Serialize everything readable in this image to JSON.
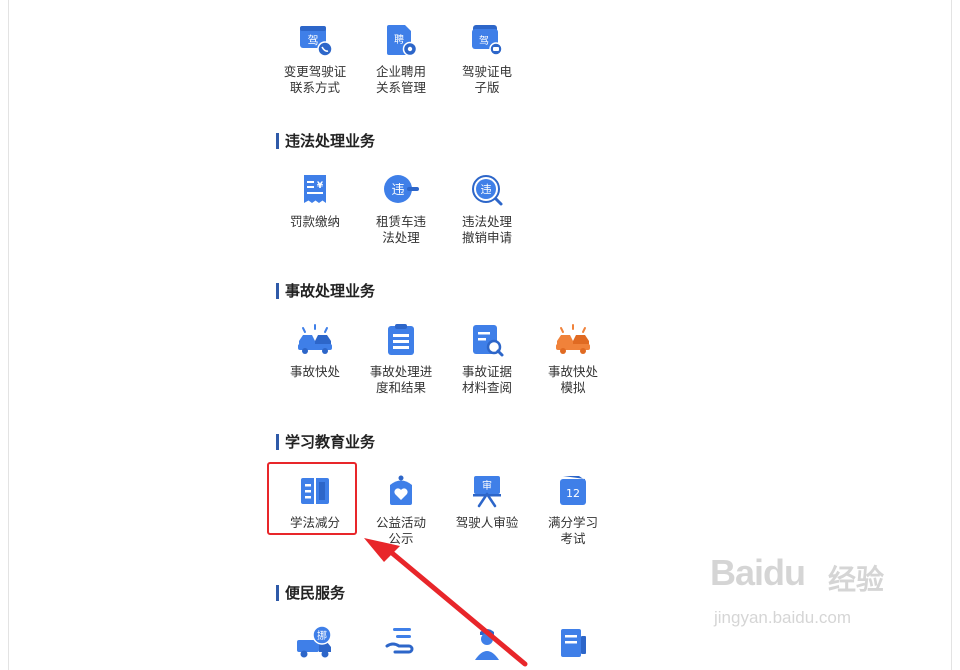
{
  "colors": {
    "icon_blue": "#3f7fe8",
    "icon_orange": "#f0823a",
    "section_bar": "#2f5aa8",
    "highlight_red": "#e8262a"
  },
  "top_row": {
    "items": [
      {
        "label": "变更驾驶证\n联系方式",
        "icon": "license-phone-icon",
        "glyph": "驾"
      },
      {
        "label": "企业聘用\n关系管理",
        "icon": "employment-doc-icon",
        "glyph": "聘"
      },
      {
        "label": "驾驶证电\n子版",
        "icon": "e-license-icon",
        "glyph": "驾"
      }
    ]
  },
  "violation": {
    "title": "违法处理业务",
    "items": [
      {
        "label": "罚款缴纳",
        "icon": "fine-receipt-icon",
        "glyph": "¥"
      },
      {
        "label": "租赁车违\n法处理",
        "icon": "rental-violation-icon",
        "glyph": "违"
      },
      {
        "label": "违法处理\n撤销申请",
        "icon": "violation-revoke-icon",
        "glyph": "违"
      }
    ]
  },
  "accident": {
    "title": "事故处理业务",
    "items": [
      {
        "label": "事故快处",
        "icon": "car-crash-icon"
      },
      {
        "label": "事故处理进\n度和结果",
        "icon": "clipboard-progress-icon"
      },
      {
        "label": "事故证据\n材料查阅",
        "icon": "document-search-icon"
      },
      {
        "label": "事故快处\n模拟",
        "icon": "car-crash-orange-icon"
      }
    ]
  },
  "education": {
    "title": "学习教育业务",
    "items": [
      {
        "label": "学法减分",
        "icon": "open-book-icon"
      },
      {
        "label": "公益活动\n公示",
        "icon": "charity-bag-icon"
      },
      {
        "label": "驾驶人审验",
        "icon": "review-easel-icon",
        "glyph": "审"
      },
      {
        "label": "满分学习\n考试",
        "icon": "calendar-12-icon",
        "glyph": "12"
      }
    ]
  },
  "convenience": {
    "title": "便民服务",
    "items": [
      {
        "icon": "tow-truck-icon",
        "glyph": "挪"
      },
      {
        "icon": "hand-list-icon"
      },
      {
        "icon": "officer-icon"
      },
      {
        "icon": "doc-card-icon"
      }
    ]
  },
  "watermark": {
    "logo": "Baidu",
    "cn": "经验",
    "url": "jingyan.baidu.com"
  }
}
